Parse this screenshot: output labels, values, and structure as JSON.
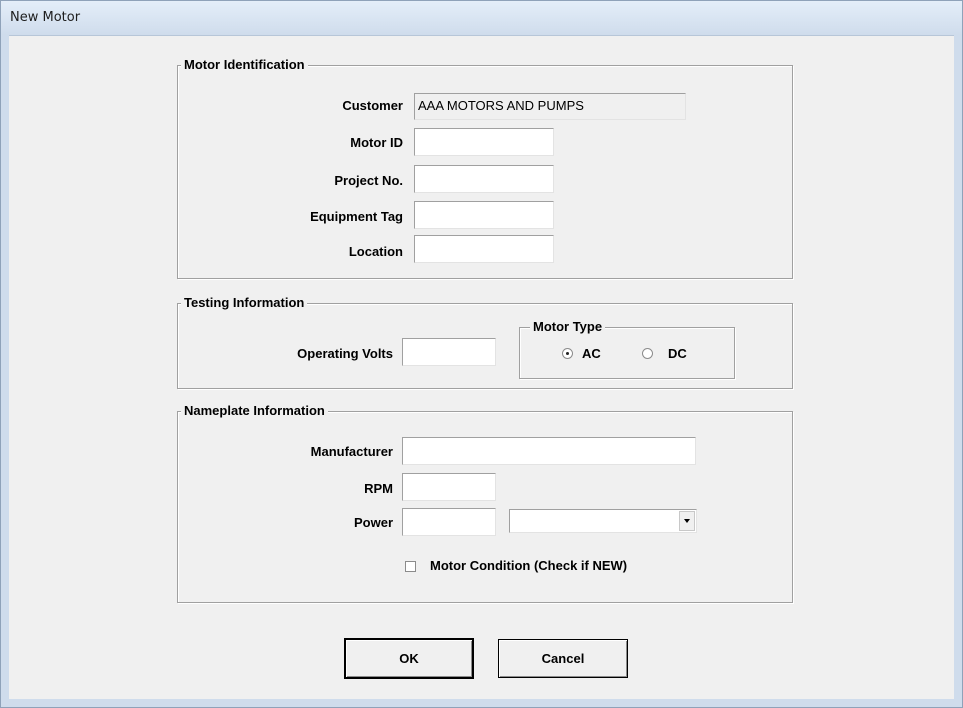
{
  "window": {
    "title": "New Motor"
  },
  "motor_identification": {
    "legend": "Motor Identification",
    "customer_label": "Customer",
    "customer_value": "AAA MOTORS AND PUMPS",
    "motor_id_label": "Motor ID",
    "motor_id_value": "",
    "project_no_label": "Project No.",
    "project_no_value": "",
    "equipment_tag_label": "Equipment Tag",
    "equipment_tag_value": "",
    "location_label": "Location",
    "location_value": ""
  },
  "testing_information": {
    "legend": "Testing Information",
    "operating_volts_label": "Operating Volts",
    "operating_volts_value": "",
    "motor_type": {
      "legend": "Motor Type",
      "ac_label": "AC",
      "dc_label": "DC",
      "selected": "AC"
    }
  },
  "nameplate_information": {
    "legend": "Nameplate Information",
    "manufacturer_label": "Manufacturer",
    "manufacturer_value": "",
    "rpm_label": "RPM",
    "rpm_value": "",
    "power_label": "Power",
    "power_value": "",
    "power_unit_selected": "",
    "motor_condition_label": "Motor Condition (Check if NEW)",
    "motor_condition_checked": false
  },
  "buttons": {
    "ok": "OK",
    "cancel": "Cancel"
  }
}
